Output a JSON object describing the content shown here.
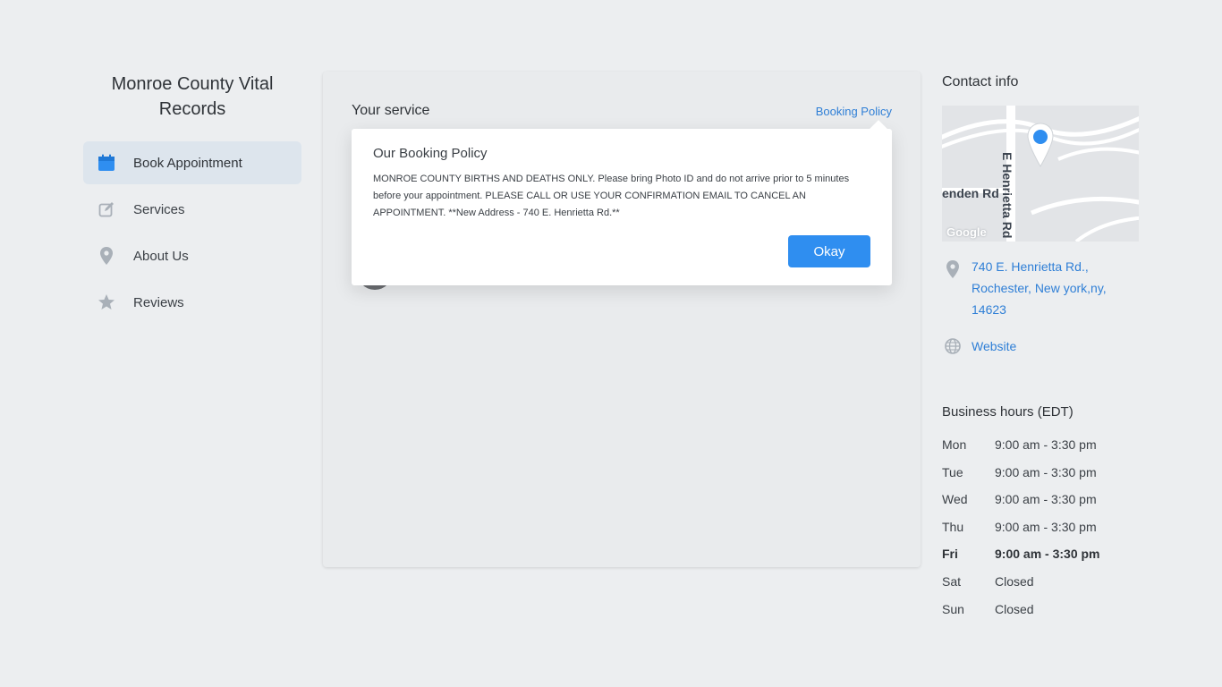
{
  "sidebar": {
    "brand": "Monroe County Vital Records",
    "items": [
      {
        "label": "Book Appointment",
        "icon": "calendar-icon",
        "active": true
      },
      {
        "label": "Services",
        "icon": "edit-icon"
      },
      {
        "label": "About Us",
        "icon": "location-pin-icon"
      },
      {
        "label": "Reviews",
        "icon": "star-icon"
      }
    ]
  },
  "main": {
    "service_title": "Your service",
    "policy_link": "Booking Policy"
  },
  "popover": {
    "title": "Our Booking Policy",
    "body": "MONROE COUNTY BIRTHS AND DEATHS ONLY. Please bring Photo ID and do not arrive prior to 5 minutes before your appointment. PLEASE CALL OR USE YOUR CONFIRMATION EMAIL TO CANCEL AN APPOINTMENT. **New Address - 740 E. Henrietta Rd.**",
    "button": "Okay"
  },
  "contact": {
    "title": "Contact info",
    "map": {
      "street1": "E Henrietta Rd",
      "street2": "enden Rd",
      "attribution": "Google"
    },
    "address": "740 E. Henrietta Rd., Rochester, New york,ny, 14623",
    "website": "Website"
  },
  "hours": {
    "title": "Business hours (EDT)",
    "rows": [
      {
        "day": "Mon",
        "time": "9:00 am - 3:30 pm"
      },
      {
        "day": "Tue",
        "time": "9:00 am - 3:30 pm"
      },
      {
        "day": "Wed",
        "time": "9:00 am - 3:30 pm"
      },
      {
        "day": "Thu",
        "time": "9:00 am - 3:30 pm"
      },
      {
        "day": "Fri",
        "time": "9:00 am - 3:30 pm",
        "today": true
      },
      {
        "day": "Sat",
        "time": "Closed"
      },
      {
        "day": "Sun",
        "time": "Closed"
      }
    ]
  },
  "colors": {
    "accent": "#2f8ef0",
    "link": "#2f7fd6",
    "active_nav_bg": "#dde5ed",
    "icon_gray": "#a9b0b8"
  }
}
